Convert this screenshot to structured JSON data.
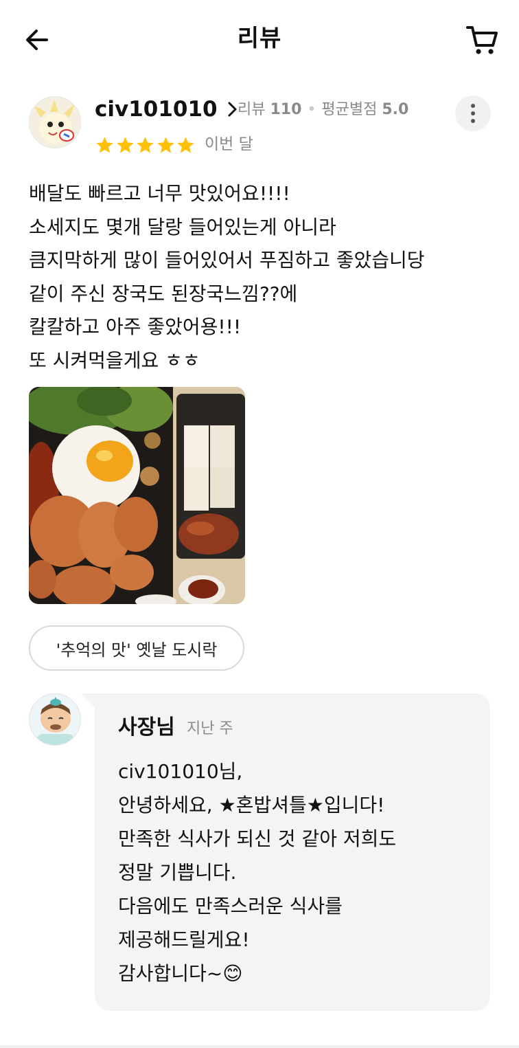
{
  "header": {
    "title": "리뷰",
    "back_icon": "arrow-left-icon",
    "cart_icon": "cart-icon"
  },
  "review": {
    "username": "civ101010",
    "review_count_label": "리뷰",
    "review_count": "110",
    "avg_rating_label": "평균별점",
    "avg_rating": "5.0",
    "rating": 5,
    "date": "이번 달",
    "star_color": "#FFC107",
    "text_lines": [
      "배달도 빠르고 너무 맛있어요!!!!",
      "소세지도 몇개 달랑 들어있는게 아니라",
      "큼지막하게 많이 들어있어서 푸짐하고 좋았습니당",
      "같이 주신 장국도 된장국느낌??에",
      "칼칼하고 아주 좋았어용!!!",
      "또 시켜먹을게요 ㅎㅎ"
    ],
    "menu_tag": "'추억의 맛' 옛날 도시락"
  },
  "owner_reply": {
    "name": "사장님",
    "date": "지난 주",
    "lines": [
      "civ101010님,",
      "안녕하세요, ★혼밥셔틀★입니다!",
      "만족한 식사가 되신 것 같아 저희도",
      "정말 기쁩니다.",
      "다음에도 만족스러운 식사를",
      "제공해드릴게요!",
      "감사합니다~😊"
    ]
  }
}
